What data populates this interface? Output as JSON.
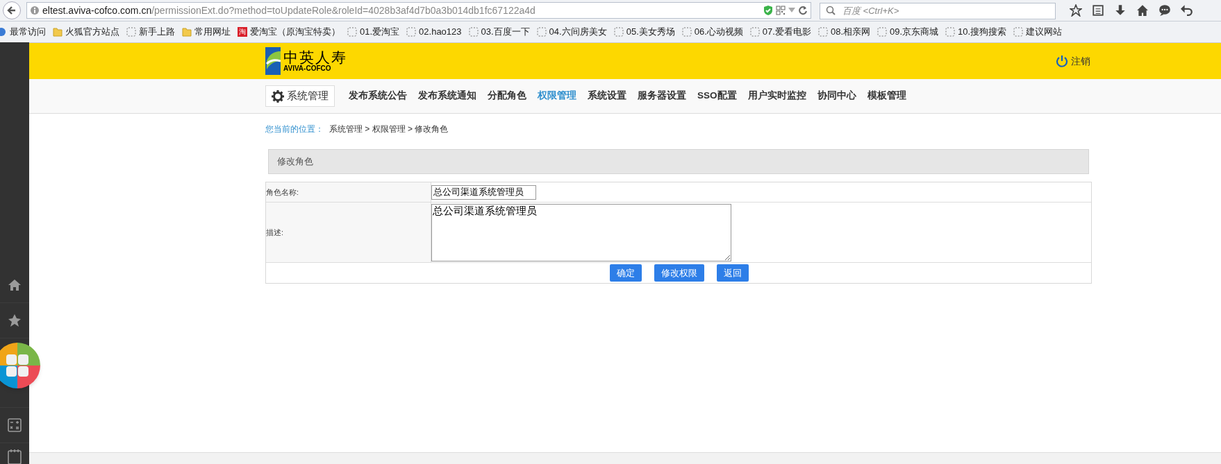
{
  "browser": {
    "url_host": "eltest.aviva-cofco.com.cn",
    "url_path": "/permissionExt.do?method=toUpdateRole&roleId=4028b3af4d7b0a3b014db1fc67122a4d",
    "search_placeholder": "百度 <Ctrl+K>"
  },
  "bookmarks": [
    {
      "label": "最常访问",
      "kind": "gear"
    },
    {
      "label": "火狐官方站点",
      "kind": "folder"
    },
    {
      "label": "新手上路",
      "kind": "page"
    },
    {
      "label": "常用网址",
      "kind": "folder"
    },
    {
      "label": "爱淘宝（原淘宝特卖）",
      "kind": "taobao",
      "icon_text": "淘"
    },
    {
      "label": "01.爱淘宝",
      "kind": "page"
    },
    {
      "label": "02.hao123",
      "kind": "page"
    },
    {
      "label": "03.百度一下",
      "kind": "page"
    },
    {
      "label": "04.六间房美女",
      "kind": "page"
    },
    {
      "label": "05.美女秀场",
      "kind": "page"
    },
    {
      "label": "06.心动视频",
      "kind": "page"
    },
    {
      "label": "07.爱看电影",
      "kind": "page"
    },
    {
      "label": "08.相亲网",
      "kind": "page"
    },
    {
      "label": "09.京东商城",
      "kind": "page"
    },
    {
      "label": "10.搜狗搜索",
      "kind": "page"
    },
    {
      "label": "建议网站",
      "kind": "page"
    }
  ],
  "header": {
    "logo_cn": "中英人寿",
    "logo_en": "AVIVA-COFCO",
    "logout": "注销"
  },
  "nav": {
    "menu_button": "系统管理",
    "items": [
      {
        "label": "发布系统公告",
        "selected": false
      },
      {
        "label": "发布系统通知",
        "selected": false
      },
      {
        "label": "分配角色",
        "selected": false
      },
      {
        "label": "权限管理",
        "selected": true
      },
      {
        "label": "系统设置",
        "selected": false
      },
      {
        "label": "服务器设置",
        "selected": false
      },
      {
        "label": "SSO配置",
        "selected": false
      },
      {
        "label": "用户实时监控",
        "selected": false
      },
      {
        "label": "协同中心",
        "selected": false
      },
      {
        "label": "模板管理",
        "selected": false
      }
    ]
  },
  "breadcrumb": {
    "label": "您当前的位置：",
    "path": "系统管理 > 权限管理 > 修改角色"
  },
  "panel_title": "修改角色",
  "form": {
    "fields": [
      {
        "label": "角色名称:",
        "kind": "input",
        "value": "总公司渠道系统管理员"
      },
      {
        "label": "描述:",
        "kind": "textarea",
        "value": "总公司渠道系统管理员"
      }
    ],
    "buttons": [
      "确定",
      "修改权限",
      "返回"
    ]
  }
}
